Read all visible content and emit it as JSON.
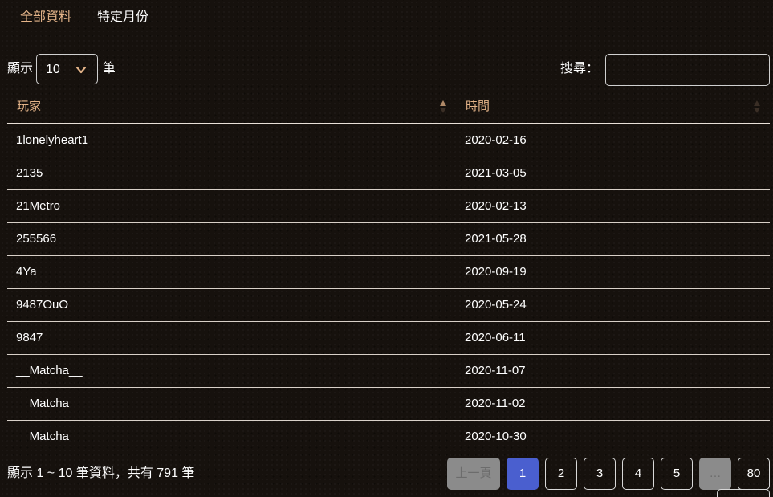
{
  "tabs": [
    {
      "label": "全部資料",
      "active": true
    },
    {
      "label": "特定月份",
      "active": false
    }
  ],
  "length_control": {
    "prefix": "顯示",
    "value": "10",
    "suffix": "筆"
  },
  "search": {
    "label": "搜尋：",
    "value": "",
    "placeholder": ""
  },
  "table": {
    "columns": [
      "玩家",
      "時間"
    ],
    "sort": {
      "column": "玩家",
      "direction": "ascending"
    },
    "rows": [
      {
        "player": "1lonelyheart1",
        "time": "2020-02-16"
      },
      {
        "player": "2135",
        "time": "2021-03-05"
      },
      {
        "player": "21Metro",
        "time": "2020-02-13"
      },
      {
        "player": "255566",
        "time": "2021-05-28"
      },
      {
        "player": "4Ya",
        "time": "2020-09-19"
      },
      {
        "player": "9487OuO",
        "time": "2020-05-24"
      },
      {
        "player": "9847",
        "time": "2020-06-11"
      },
      {
        "player": "__Matcha__",
        "time": "2020-11-07"
      },
      {
        "player": "__Matcha__",
        "time": "2020-11-02"
      },
      {
        "player": "__Matcha__",
        "time": "2020-10-30"
      }
    ]
  },
  "info": "顯示 1 ~ 10 筆資料，共有 791 筆",
  "pagination": {
    "prev": "上一頁",
    "pages": [
      "1",
      "2",
      "3",
      "4",
      "5"
    ],
    "current": "1",
    "ellipsis": "…",
    "last": "80"
  },
  "colors": {
    "accent": "#e4b489",
    "background": "#16110d",
    "active_page": "#4a5fcf",
    "disabled": "#8b8b8b"
  }
}
